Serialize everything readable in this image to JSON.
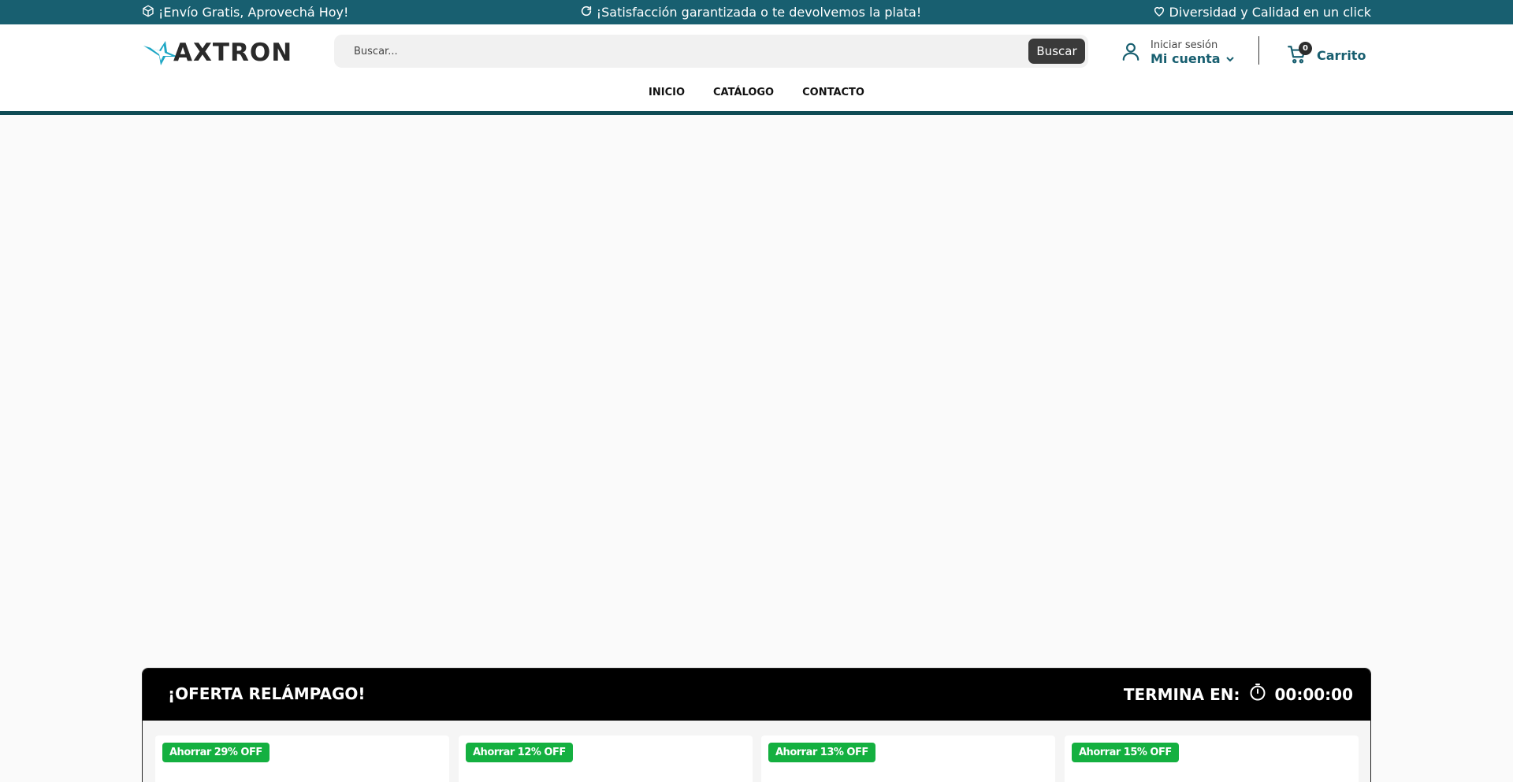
{
  "topbar": {
    "shipping": "¡Envío Gratis, Aprovechá Hoy!",
    "guarantee": "¡Satisfacción garantizada o te devolvemos la plata!",
    "diversity": "Diversidad y Calidad en un click"
  },
  "brand": {
    "name": "AXTRON",
    "accent": "#1ea7c5",
    "dark": "#2a2a2a"
  },
  "search": {
    "placeholder": "Buscar...",
    "button": "Buscar"
  },
  "account": {
    "small": "Iniciar sesión",
    "big": "Mi cuenta"
  },
  "cart": {
    "count": "0",
    "label": "Carrito"
  },
  "nav": {
    "items": [
      "INICIO",
      "CATÁLOGO",
      "CONTACTO"
    ]
  },
  "flash": {
    "title": "¡OFERTA RELÁMPAGO!",
    "ends_label": "TERMINA EN:",
    "countdown": "00:00:00",
    "cards": [
      {
        "badge": "Ahorrar 29% OFF"
      },
      {
        "badge": "Ahorrar 12% OFF"
      },
      {
        "badge": "Ahorrar 13% OFF"
      },
      {
        "badge": "Ahorrar 15% OFF"
      }
    ]
  },
  "colors": {
    "topbar": "#185f70",
    "primary_text": "#185f70",
    "badge_green": "#14b040",
    "flash_header": "#000000"
  }
}
